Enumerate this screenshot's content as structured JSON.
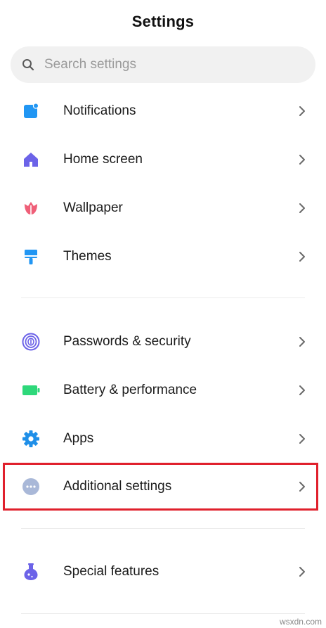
{
  "header": {
    "title": "Settings"
  },
  "search": {
    "placeholder": "Search settings",
    "value": ""
  },
  "items": [
    {
      "label": "Notifications",
      "icon": "notifications-icon",
      "color": "#2196f3"
    },
    {
      "label": "Home screen",
      "icon": "home-icon",
      "color": "#6c63e8"
    },
    {
      "label": "Wallpaper",
      "icon": "tulip-icon",
      "color": "#ef5f78"
    },
    {
      "label": "Themes",
      "icon": "paint-brush-icon",
      "color": "#2196f3"
    },
    {
      "label": "Passwords & security",
      "icon": "fingerprint-icon",
      "color": "#6c63e8"
    },
    {
      "label": "Battery & performance",
      "icon": "battery-icon",
      "color": "#2ed87a"
    },
    {
      "label": "Apps",
      "icon": "gear-icon",
      "color": "#1f8fe8"
    },
    {
      "label": "Additional settings",
      "icon": "more-dots-icon",
      "color": "#a9b8d8"
    },
    {
      "label": "Special features",
      "icon": "flask-icon",
      "color": "#6c63e8"
    }
  ],
  "highlight_color": "#e0202c",
  "watermark": "wsxdn.com"
}
